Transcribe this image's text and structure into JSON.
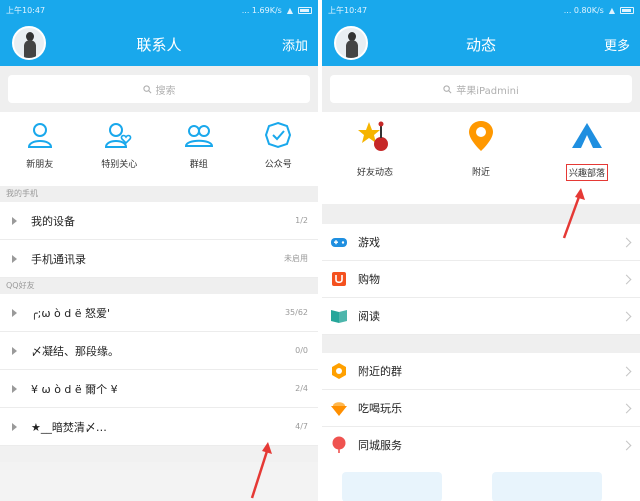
{
  "left": {
    "status": {
      "time": "上午10:47",
      "net": "... 1.69K/s"
    },
    "header": {
      "title": "联系人",
      "action": "添加"
    },
    "search": {
      "placeholder": "搜索"
    },
    "quick": [
      {
        "label": "新朋友",
        "icon": "new-friend-icon"
      },
      {
        "label": "特别关心",
        "icon": "special-care-icon"
      },
      {
        "label": "群组",
        "icon": "group-icon"
      },
      {
        "label": "公众号",
        "icon": "official-account-icon"
      }
    ],
    "section_phone": "我的手机",
    "phone_rows": [
      {
        "name": "我的设备",
        "count": "1/2"
      },
      {
        "name": "手机通讯录",
        "count": "未启用"
      }
    ],
    "section_qq": "QQ好友",
    "friend_rows": [
      {
        "name": "╭;ω ò d ë 怒爱'",
        "count": "35/62"
      },
      {
        "name": "〆凝结、那段缘。",
        "count": "0/0"
      },
      {
        "name": "¥ ω ò d ë 爾个 ¥",
        "count": "2/4"
      },
      {
        "name": "★__暗焚清〆…",
        "count": "4/7"
      }
    ]
  },
  "right": {
    "status": {
      "time": "上午10:47",
      "net": "... 0.80K/s"
    },
    "header": {
      "title": "动态",
      "action": "更多"
    },
    "search": {
      "placeholder": "苹果iPadmini"
    },
    "quick": [
      {
        "label": "好友动态",
        "icon": "friend-feed-icon"
      },
      {
        "label": "附近",
        "icon": "nearby-icon"
      },
      {
        "label": "兴趣部落",
        "icon": "interest-tribe-icon"
      }
    ],
    "group1": [
      {
        "name": "游戏",
        "icon": "game-icon"
      },
      {
        "name": "购物",
        "icon": "shopping-icon"
      },
      {
        "name": "阅读",
        "icon": "reading-icon"
      }
    ],
    "group2": [
      {
        "name": "附近的群",
        "icon": "nearby-group-icon"
      },
      {
        "name": "吃喝玩乐",
        "icon": "food-fun-icon"
      },
      {
        "name": "同城服务",
        "icon": "local-service-icon"
      }
    ]
  },
  "colors": {
    "brand": "#19a8ec",
    "highlight": "#e53935"
  }
}
